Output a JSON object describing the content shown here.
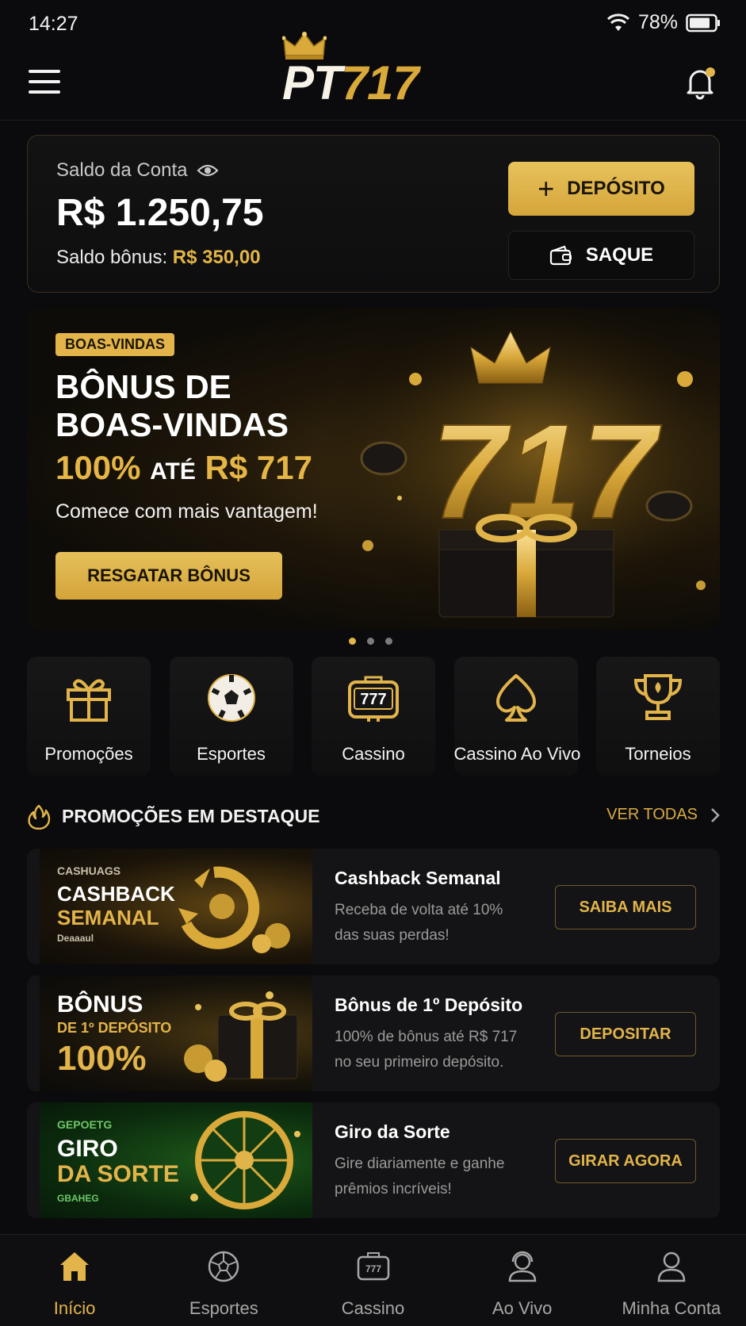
{
  "status_bar": {
    "time": "14:27",
    "battery": "78%"
  },
  "header": {
    "logo_pt": "PT",
    "logo_num": "717"
  },
  "balance": {
    "label": "Saldo da Conta",
    "amount": "R$ 1.250,75",
    "bonus_label": "Saldo bônus:",
    "bonus_value": "R$ 350,00",
    "deposit_label": "DEPÓSITO",
    "withdraw_label": "SAQUE"
  },
  "banner": {
    "badge": "BOAS-VINDAS",
    "title_line1": "BÔNUS DE",
    "title_line2": "BOAS-VINDAS",
    "percent": "100%",
    "ate": "ATÉ",
    "amount": "R$ 717",
    "subtitle": "Comece com mais vantagem!",
    "button": "RESGATAR BÔNUS",
    "art_text": "717",
    "active_slide": 1,
    "slide_count": 3
  },
  "categories": [
    {
      "label": "Promoções",
      "icon": "gift-icon"
    },
    {
      "label": "Esportes",
      "icon": "soccer-ball-icon"
    },
    {
      "label": "Cassino",
      "icon": "slot-machine-icon"
    },
    {
      "label": "Cassino Ao Vivo",
      "icon": "spade-icon"
    },
    {
      "label": "Torneios",
      "icon": "trophy-icon"
    }
  ],
  "promos_section": {
    "title": "PROMOÇÕES EM DESTAQUE",
    "see_all": "VER TODAS"
  },
  "promos": [
    {
      "img_small": "CASHUAGS",
      "img_line1": "CASHBACK",
      "img_line2": "SEMANAL",
      "img_footer": "Deaaaul",
      "title": "Cashback Semanal",
      "desc": "Receba de volta até 10% das suas perdas!",
      "button": "SAIBA MAIS"
    },
    {
      "img_line1": "BÔNUS",
      "img_line2": "DE 1º DEPÓSITO",
      "img_line3": "100%",
      "title": "Bônus de 1º Depósito",
      "desc": "100% de bônus até R$ 717 no seu primeiro depósito.",
      "button": "DEPOSITAR"
    },
    {
      "img_small": "GEPOETG",
      "img_line1": "GIRO",
      "img_line2": "DA SORTE",
      "img_footer": "GBAHEG",
      "title": "Giro da Sorte",
      "desc": "Gire diariamente e ganhe prêmios incríveis!",
      "button": "GIRAR AGORA"
    }
  ],
  "bottom_nav": [
    {
      "label": "Início",
      "icon": "home-icon",
      "active": true
    },
    {
      "label": "Esportes",
      "icon": "soccer-ball-icon",
      "active": false
    },
    {
      "label": "Cassino",
      "icon": "slot-machine-icon",
      "active": false
    },
    {
      "label": "Ao Vivo",
      "icon": "live-dealer-icon",
      "active": false
    },
    {
      "label": "Minha Conta",
      "icon": "user-icon",
      "active": false
    }
  ],
  "colors": {
    "accent": "#E2B44A",
    "background": "#0B0B0D",
    "card": "#141416"
  }
}
